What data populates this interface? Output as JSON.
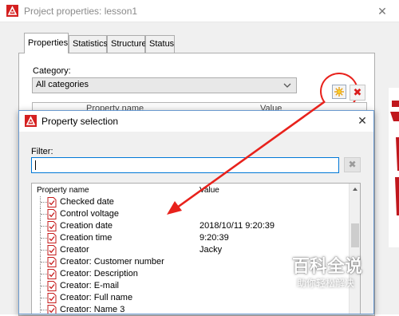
{
  "outer_window": {
    "title": "Project properties: lesson1",
    "app_icon": "eplan-logo-icon",
    "close_glyph": "✕"
  },
  "tabs": [
    {
      "label": "Properties",
      "active": true
    },
    {
      "label": "Statistics",
      "active": false
    },
    {
      "label": "Structure",
      "active": false
    },
    {
      "label": "Status",
      "active": false
    }
  ],
  "category": {
    "label": "Category:",
    "selected": "All categories"
  },
  "toolbar": {
    "add_icon": "new-property-icon",
    "delete_glyph": "✖"
  },
  "outer_table": {
    "col_name": "Property name",
    "col_value": "Value"
  },
  "dialog": {
    "title": "Property selection",
    "close_glyph": "✕",
    "filter_label": "Filter:",
    "filter_value": "",
    "filter_clear_glyph": "✖",
    "col_name": "Property name",
    "col_value": "Value",
    "rows": [
      {
        "name": "Checked date",
        "value": ""
      },
      {
        "name": "Control voltage",
        "value": ""
      },
      {
        "name": "Creation date",
        "value": "2018/10/11 9:20:39"
      },
      {
        "name": "Creation time",
        "value": "9:20:39"
      },
      {
        "name": "Creator",
        "value": "Jacky"
      },
      {
        "name": "Creator: Customer number",
        "value": ""
      },
      {
        "name": "Creator: Description",
        "value": ""
      },
      {
        "name": "Creator: E-mail",
        "value": ""
      },
      {
        "name": "Creator: Full name",
        "value": ""
      },
      {
        "name": "Creator: Name 3",
        "value": ""
      }
    ]
  },
  "annotation": {
    "circle_color": "#e8221c",
    "arrow_color": "#e8221c"
  },
  "watermark": {
    "big": "百科全说",
    "small": "助你轻松解决"
  }
}
